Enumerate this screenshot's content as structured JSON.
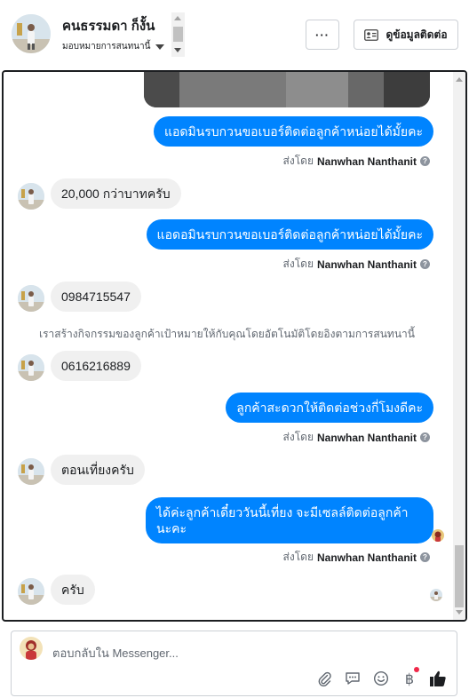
{
  "header": {
    "contact_name": "คนธรรมดา ก็งั้น",
    "assign_label": "มอบหมายการสนทนานี้",
    "more_label": "···",
    "view_contact_label": "ดูข้อมูลติดต่อ"
  },
  "messages": [
    {
      "dir": "out",
      "text": "แอดมินรบกวนขอเบอร์ติดต่อลูกค้าหน่อยได้มั้ยคะ"
    },
    {
      "dir": "in",
      "text": "20,000 กว่าบาทครับ"
    },
    {
      "dir": "out",
      "text": "แอดอมินรบกวนขอเบอร์ติดต่อลูกค้าหน่อยได้มั้ยคะ"
    },
    {
      "dir": "in",
      "text": "0984715547"
    },
    {
      "dir": "in",
      "text": "0616216889"
    },
    {
      "dir": "out",
      "text": "ลูกค้าสะดวกให้ติดต่อช่วงกี่โมงดีคะ"
    },
    {
      "dir": "in",
      "text": "ตอนเที่ยงครับ"
    },
    {
      "dir": "out",
      "text": "ได้ค่ะลูกค้าเดี๋ยววันนี้เที่ยง จะมีเซลล์ติดต่อลูกค้านะคะ"
    },
    {
      "dir": "in",
      "text": "ครับ"
    }
  ],
  "sent_by": {
    "prefix": "ส่งโดย",
    "name": "Nanwhan Nanthanit"
  },
  "system_note": "เราสร้างกิจกรรมของลูกค้าเป้าหมายให้กับคุณโดยอัตโนมัติโดยอิงตามการสนทนานี้",
  "composer": {
    "placeholder": "ตอบกลับใน Messenger..."
  },
  "colors": {
    "outgoing_bubble": "#0084ff",
    "incoming_bubble": "#f0f0f0",
    "like": "#1c1e21"
  },
  "icons": [
    "more-icon",
    "contact-card-icon",
    "attachment-icon",
    "saved-replies-icon",
    "emoji-icon",
    "payment-icon",
    "like-icon"
  ]
}
